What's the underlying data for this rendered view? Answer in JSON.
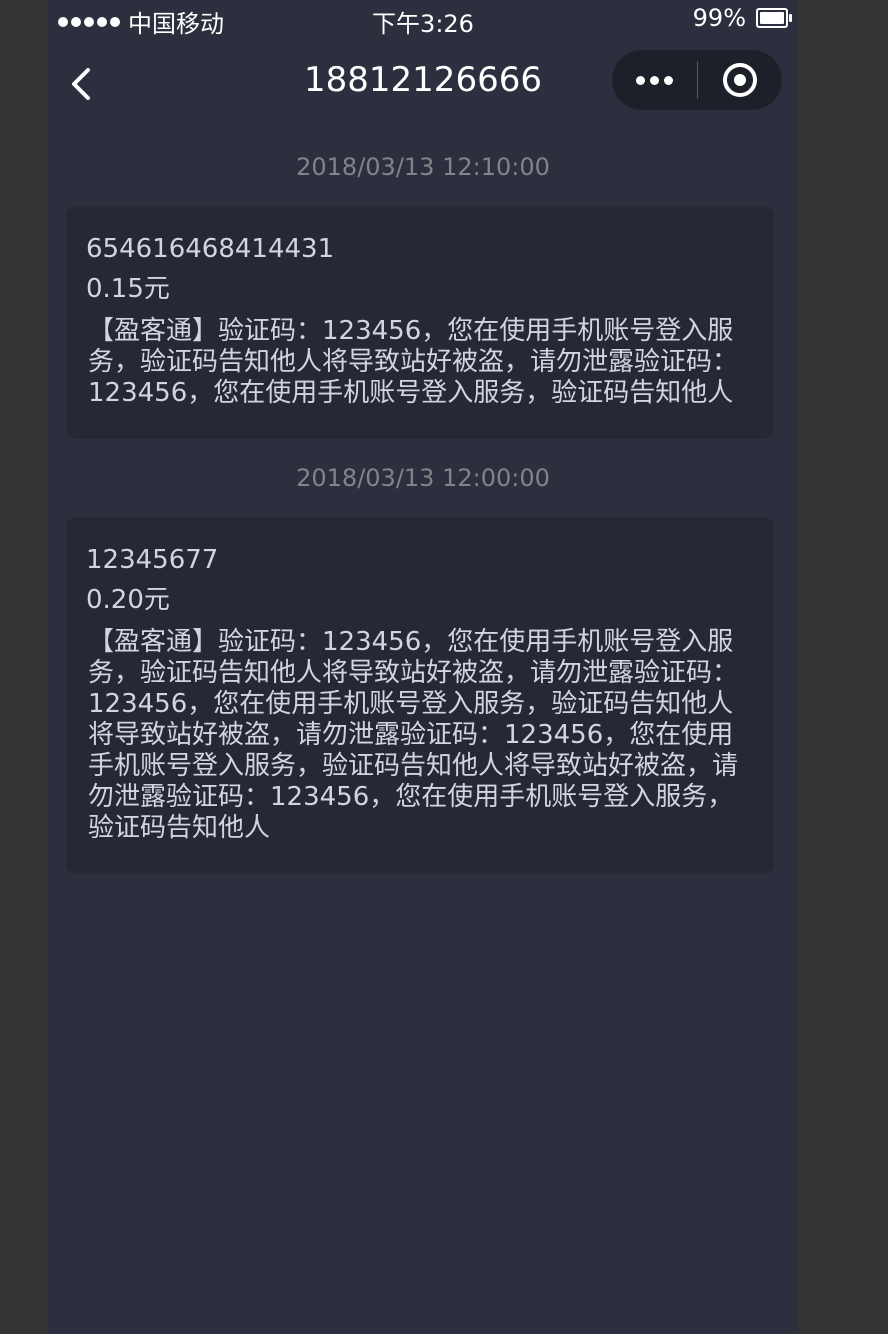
{
  "status_bar": {
    "carrier": "中国移动",
    "time": "下午3:26",
    "battery": "99%",
    "battery_level": 0.99
  },
  "nav": {
    "title": "18812126666"
  },
  "messages": [
    {
      "timestamp": "2018/03/13 12:10:00",
      "sender": "654616468414431",
      "price": "0.15元",
      "body": "【盈客通】验证码：123456，您在使用手机账号登入服务，验证码告知他人将导致站好被盗，请勿泄露验证码：123456，您在使用手机账号登入服务，验证码告知他人"
    },
    {
      "timestamp": "2018/03/13 12:00:00",
      "sender": "12345677",
      "price": "0.20元",
      "body": "【盈客通】验证码：123456，您在使用手机账号登入服务，验证码告知他人将导致站好被盗，请勿泄露验证码：123456，您在使用手机账号登入服务，验证码告知他人将导致站好被盗，请勿泄露验证码：123456，您在使用手机账号登入服务，验证码告知他人将导致站好被盗，请勿泄露验证码：123456，您在使用手机账号登入服务，验证码告知他人"
    }
  ],
  "colors": {
    "page_bg": "#2c2f3d",
    "card_bg": "#262933",
    "timestamp_text": "#828489",
    "primary_text": "#d0d5e1"
  }
}
